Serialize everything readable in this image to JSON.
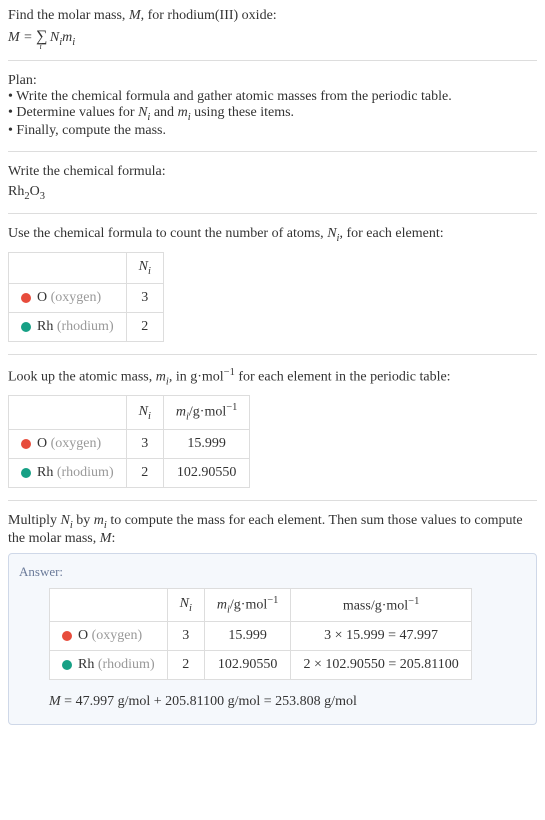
{
  "intro": {
    "line1": "Find the molar mass, ",
    "var_M": "M",
    "line1_end": ", for rhodium(III) oxide:",
    "formula_M": "M",
    "formula_eq": " = ",
    "formula_sigma": "∑",
    "formula_sigma_sub": "i",
    "formula_Ni": "N",
    "formula_Ni_sub": "i",
    "formula_mi": "m",
    "formula_mi_sub": "i"
  },
  "plan": {
    "title": "Plan:",
    "item1_a": "• Write the chemical formula and gather atomic masses from the periodic table.",
    "item2_a": "• Determine values for ",
    "item2_Ni": "N",
    "item2_Ni_sub": "i",
    "item2_mid": " and ",
    "item2_mi": "m",
    "item2_mi_sub": "i",
    "item2_end": " using these items.",
    "item3": "• Finally, compute the mass."
  },
  "write_formula": {
    "title": "Write the chemical formula:",
    "rh": "Rh",
    "rh_sub": "2",
    "o": "O",
    "o_sub": "3"
  },
  "count_atoms": {
    "line_a": "Use the chemical formula to count the number of atoms, ",
    "Ni": "N",
    "Ni_sub": "i",
    "line_b": ", for each element:",
    "header_Ni": "N",
    "header_Ni_sub": "i",
    "row1_elem": "O",
    "row1_name": "(oxygen)",
    "row1_n": "3",
    "row2_elem": "Rh",
    "row2_name": "(rhodium)",
    "row2_n": "2"
  },
  "atomic_mass": {
    "line_a": "Look up the atomic mass, ",
    "mi": "m",
    "mi_sub": "i",
    "line_b": ", in g·mol",
    "line_sup": "−1",
    "line_c": " for each element in the periodic table:",
    "header_Ni": "N",
    "header_Ni_sub": "i",
    "header_mi": "m",
    "header_mi_sub": "i",
    "header_unit": "/g·mol",
    "header_unit_sup": "−1",
    "row1_elem": "O",
    "row1_name": "(oxygen)",
    "row1_n": "3",
    "row1_m": "15.999",
    "row2_elem": "Rh",
    "row2_name": "(rhodium)",
    "row2_n": "2",
    "row2_m": "102.90550"
  },
  "multiply": {
    "line_a": "Multiply ",
    "Ni": "N",
    "Ni_sub": "i",
    "mid": " by ",
    "mi": "m",
    "mi_sub": "i",
    "line_b": " to compute the mass for each element. Then sum those values to compute the molar mass, ",
    "M": "M",
    "line_c": ":"
  },
  "answer": {
    "label": "Answer:",
    "header_Ni": "N",
    "header_Ni_sub": "i",
    "header_mi": "m",
    "header_mi_sub": "i",
    "header_unit": "/g·mol",
    "header_unit_sup": "−1",
    "header_mass": "mass/g·mol",
    "header_mass_sup": "−1",
    "row1_elem": "O",
    "row1_name": "(oxygen)",
    "row1_n": "3",
    "row1_m": "15.999",
    "row1_calc": "3 × 15.999 = 47.997",
    "row2_elem": "Rh",
    "row2_name": "(rhodium)",
    "row2_n": "2",
    "row2_m": "102.90550",
    "row2_calc": "2 × 102.90550 = 205.81100",
    "final_M": "M",
    "final_eq": " = 47.997 g/mol + 205.81100 g/mol = 253.808 g/mol"
  }
}
